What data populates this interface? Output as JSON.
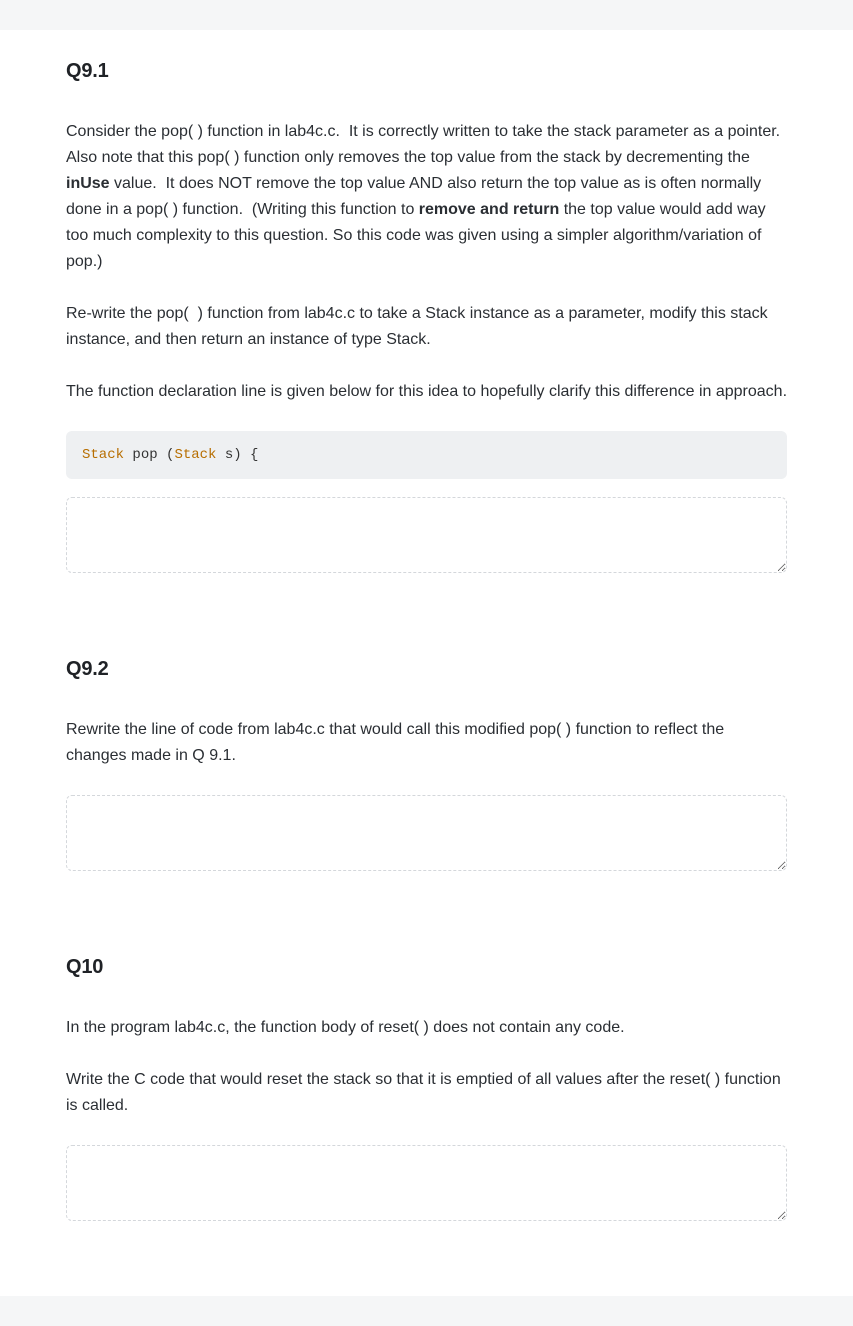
{
  "questions": [
    {
      "id": "q9-1",
      "title": "Q9.1",
      "body_html": "Consider the pop( ) function in lab4c.c.  It is correctly written to take the stack parameter as a pointer.  Also note that this pop( ) function only removes the top value from the stack by decrementing the <b>inUse</b> value.  It does NOT remove the top value AND also return the top value as is often normally done in a pop( ) function.  (Writing this function to <b>remove and return</b> the top value would add way too much complexity to this question. So this code was given using a simpler algorithm/variation of pop.)\n\nRe-write the pop(  ) function from lab4c.c to take a Stack instance as a parameter, modify this stack instance, and then return an instance of type Stack.\n\nThe function declaration line is given below for this idea to hopefully clarify this difference in approach.",
      "code_tokens": [
        {
          "t": "Stack",
          "c": "tok-type"
        },
        {
          "t": " pop (",
          "c": ""
        },
        {
          "t": "Stack",
          "c": "tok-type"
        },
        {
          "t": " s) {",
          "c": ""
        }
      ],
      "answer_value": ""
    },
    {
      "id": "q9-2",
      "title": "Q9.2",
      "body_html": "Rewrite the line of code from lab4c.c that would call this modified pop( ) function to reflect the changes made in Q 9.1.",
      "code_tokens": null,
      "answer_value": ""
    },
    {
      "id": "q10",
      "title": "Q10",
      "body_html": "In the program lab4c.c, the function body of reset( ) does not contain any code.\n\nWrite the C code that would reset the stack so that it is emptied of all values after the reset( ) function is called.",
      "code_tokens": null,
      "answer_value": ""
    }
  ]
}
